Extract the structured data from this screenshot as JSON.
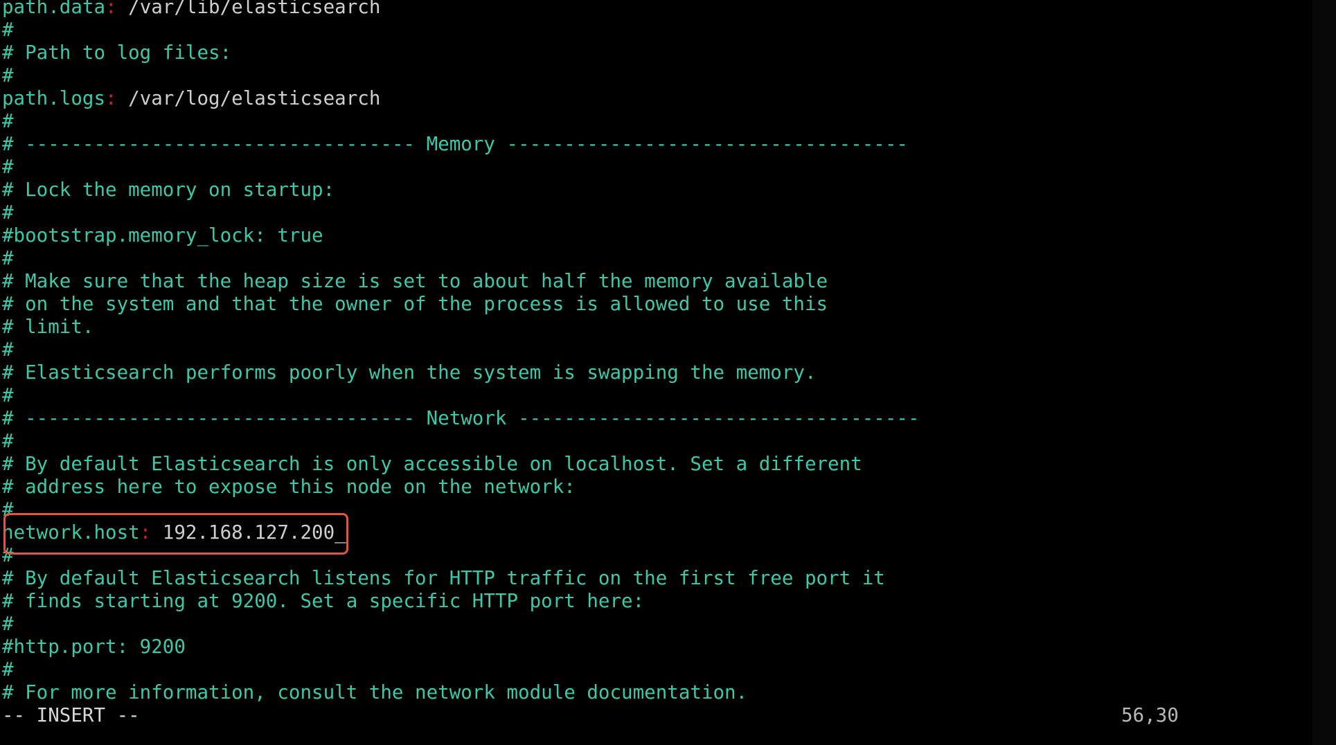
{
  "colors": {
    "comment": "#3cc9a9",
    "key": "#3cc9a9",
    "separator": "#c8202a",
    "value": "#cfcfcf",
    "highlight": "#e2573b"
  },
  "lines": [
    {
      "key": "path.data",
      "value": " /var/lib/elasticsearch"
    },
    {
      "comment": "#"
    },
    {
      "comment": "# Path to log files:"
    },
    {
      "comment": "#"
    },
    {
      "key": "path.logs",
      "value": " /var/log/elasticsearch"
    },
    {
      "comment": "#"
    },
    {
      "comment": "# ---------------------------------- Memory -----------------------------------"
    },
    {
      "comment": "#"
    },
    {
      "comment": "# Lock the memory on startup:"
    },
    {
      "comment": "#"
    },
    {
      "comment": "#bootstrap.memory_lock: true"
    },
    {
      "comment": "#"
    },
    {
      "comment": "# Make sure that the heap size is set to about half the memory available"
    },
    {
      "comment": "# on the system and that the owner of the process is allowed to use this"
    },
    {
      "comment": "# limit."
    },
    {
      "comment": "#"
    },
    {
      "comment": "# Elasticsearch performs poorly when the system is swapping the memory."
    },
    {
      "comment": "#"
    },
    {
      "comment": "# ---------------------------------- Network -----------------------------------"
    },
    {
      "comment": "#"
    },
    {
      "comment": "# By default Elasticsearch is only accessible on localhost. Set a different"
    },
    {
      "comment": "# address here to expose this node on the network:"
    },
    {
      "comment": "#"
    },
    {
      "key": "network.host",
      "value": " 192.168.127.200",
      "cursor": "_"
    },
    {
      "comment": "#"
    },
    {
      "comment": "# By default Elasticsearch listens for HTTP traffic on the first free port it"
    },
    {
      "comment": "# finds starting at 9200. Set a specific HTTP port here:"
    },
    {
      "comment": "#"
    },
    {
      "comment": "#http.port: 9200"
    },
    {
      "comment": "#"
    },
    {
      "comment": "# For more information, consult the network module documentation."
    }
  ],
  "status": {
    "mode": "-- INSERT --",
    "position": "56,30"
  }
}
